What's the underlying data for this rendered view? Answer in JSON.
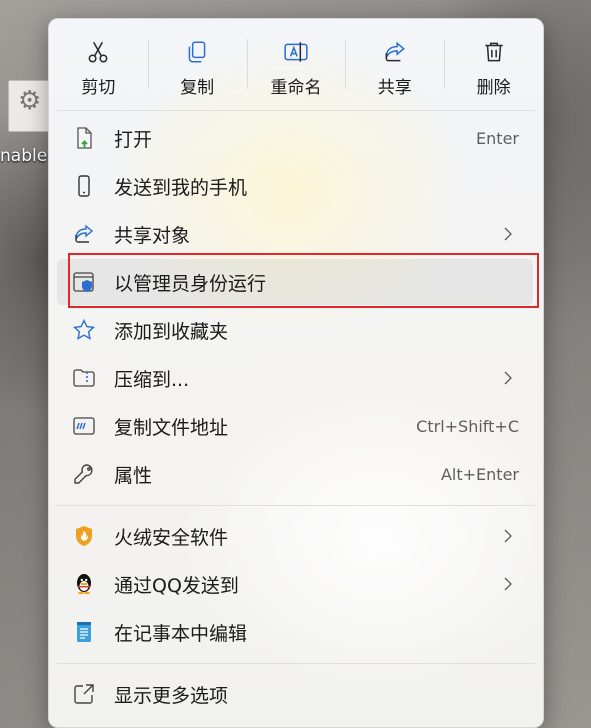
{
  "desktop": {
    "icon_label": "nable",
    "icon_name": "gear-settings-icon"
  },
  "toolbar": {
    "items": [
      {
        "label": "剪切",
        "icon": "scissors-icon"
      },
      {
        "label": "复制",
        "icon": "copy-icon"
      },
      {
        "label": "重命名",
        "icon": "rename-icon"
      },
      {
        "label": "共享",
        "icon": "share-icon"
      },
      {
        "label": "删除",
        "icon": "trash-icon"
      }
    ]
  },
  "menu": {
    "items": [
      {
        "label": "打开",
        "shortcut": "Enter",
        "icon": "file-open-icon"
      },
      {
        "label": "发送到我的手机",
        "icon": "phone-icon"
      },
      {
        "label": "共享对象",
        "icon": "share-icon",
        "submenu": true
      },
      {
        "label": "以管理员身份运行",
        "icon": "shield-admin-icon",
        "highlighted": true
      },
      {
        "label": "添加到收藏夹",
        "icon": "star-icon"
      },
      {
        "label": "压缩到...",
        "icon": "zip-folder-icon",
        "submenu": true
      },
      {
        "label": "复制文件地址",
        "shortcut": "Ctrl+Shift+C",
        "icon": "copy-path-icon"
      },
      {
        "label": "属性",
        "shortcut": "Alt+Enter",
        "icon": "wrench-icon"
      },
      {
        "label": "火绒安全软件",
        "icon": "huorong-icon",
        "submenu": true
      },
      {
        "label": "通过QQ发送到",
        "icon": "qq-icon",
        "submenu": true
      },
      {
        "label": "在记事本中编辑",
        "icon": "notepad-icon"
      },
      {
        "label": "显示更多选项",
        "icon": "external-icon"
      }
    ]
  },
  "colors": {
    "highlight_border": "#e0282e",
    "accent_blue": "#2a6fd1",
    "huorong_orange": "#f0a020"
  }
}
